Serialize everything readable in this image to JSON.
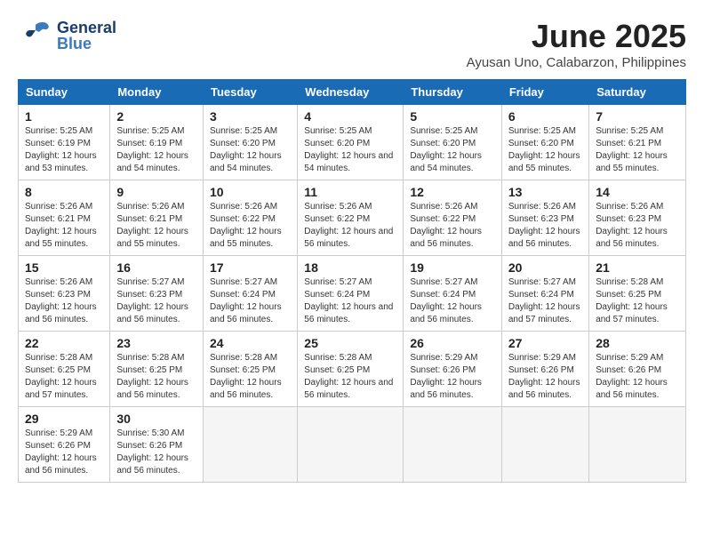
{
  "header": {
    "logo_general": "General",
    "logo_blue": "Blue",
    "month_title": "June 2025",
    "location": "Ayusan Uno, Calabarzon, Philippines"
  },
  "calendar": {
    "days_of_week": [
      "Sunday",
      "Monday",
      "Tuesday",
      "Wednesday",
      "Thursday",
      "Friday",
      "Saturday"
    ],
    "weeks": [
      [
        {
          "day": "",
          "empty": true
        },
        {
          "day": "",
          "empty": true
        },
        {
          "day": "",
          "empty": true
        },
        {
          "day": "",
          "empty": true
        },
        {
          "day": "",
          "empty": true
        },
        {
          "day": "",
          "empty": true
        },
        {
          "day": "",
          "empty": true
        }
      ]
    ],
    "cells": [
      {
        "day": "1",
        "sunrise": "5:25 AM",
        "sunset": "6:19 PM",
        "daylight": "12 hours and 53 minutes."
      },
      {
        "day": "2",
        "sunrise": "5:25 AM",
        "sunset": "6:19 PM",
        "daylight": "12 hours and 54 minutes."
      },
      {
        "day": "3",
        "sunrise": "5:25 AM",
        "sunset": "6:20 PM",
        "daylight": "12 hours and 54 minutes."
      },
      {
        "day": "4",
        "sunrise": "5:25 AM",
        "sunset": "6:20 PM",
        "daylight": "12 hours and 54 minutes."
      },
      {
        "day": "5",
        "sunrise": "5:25 AM",
        "sunset": "6:20 PM",
        "daylight": "12 hours and 54 minutes."
      },
      {
        "day": "6",
        "sunrise": "5:25 AM",
        "sunset": "6:20 PM",
        "daylight": "12 hours and 55 minutes."
      },
      {
        "day": "7",
        "sunrise": "5:25 AM",
        "sunset": "6:21 PM",
        "daylight": "12 hours and 55 minutes."
      },
      {
        "day": "8",
        "sunrise": "5:26 AM",
        "sunset": "6:21 PM",
        "daylight": "12 hours and 55 minutes."
      },
      {
        "day": "9",
        "sunrise": "5:26 AM",
        "sunset": "6:21 PM",
        "daylight": "12 hours and 55 minutes."
      },
      {
        "day": "10",
        "sunrise": "5:26 AM",
        "sunset": "6:22 PM",
        "daylight": "12 hours and 55 minutes."
      },
      {
        "day": "11",
        "sunrise": "5:26 AM",
        "sunset": "6:22 PM",
        "daylight": "12 hours and 56 minutes."
      },
      {
        "day": "12",
        "sunrise": "5:26 AM",
        "sunset": "6:22 PM",
        "daylight": "12 hours and 56 minutes."
      },
      {
        "day": "13",
        "sunrise": "5:26 AM",
        "sunset": "6:23 PM",
        "daylight": "12 hours and 56 minutes."
      },
      {
        "day": "14",
        "sunrise": "5:26 AM",
        "sunset": "6:23 PM",
        "daylight": "12 hours and 56 minutes."
      },
      {
        "day": "15",
        "sunrise": "5:26 AM",
        "sunset": "6:23 PM",
        "daylight": "12 hours and 56 minutes."
      },
      {
        "day": "16",
        "sunrise": "5:27 AM",
        "sunset": "6:23 PM",
        "daylight": "12 hours and 56 minutes."
      },
      {
        "day": "17",
        "sunrise": "5:27 AM",
        "sunset": "6:24 PM",
        "daylight": "12 hours and 56 minutes."
      },
      {
        "day": "18",
        "sunrise": "5:27 AM",
        "sunset": "6:24 PM",
        "daylight": "12 hours and 56 minutes."
      },
      {
        "day": "19",
        "sunrise": "5:27 AM",
        "sunset": "6:24 PM",
        "daylight": "12 hours and 56 minutes."
      },
      {
        "day": "20",
        "sunrise": "5:27 AM",
        "sunset": "6:24 PM",
        "daylight": "12 hours and 57 minutes."
      },
      {
        "day": "21",
        "sunrise": "5:28 AM",
        "sunset": "6:25 PM",
        "daylight": "12 hours and 57 minutes."
      },
      {
        "day": "22",
        "sunrise": "5:28 AM",
        "sunset": "6:25 PM",
        "daylight": "12 hours and 57 minutes."
      },
      {
        "day": "23",
        "sunrise": "5:28 AM",
        "sunset": "6:25 PM",
        "daylight": "12 hours and 56 minutes."
      },
      {
        "day": "24",
        "sunrise": "5:28 AM",
        "sunset": "6:25 PM",
        "daylight": "12 hours and 56 minutes."
      },
      {
        "day": "25",
        "sunrise": "5:28 AM",
        "sunset": "6:25 PM",
        "daylight": "12 hours and 56 minutes."
      },
      {
        "day": "26",
        "sunrise": "5:29 AM",
        "sunset": "6:26 PM",
        "daylight": "12 hours and 56 minutes."
      },
      {
        "day": "27",
        "sunrise": "5:29 AM",
        "sunset": "6:26 PM",
        "daylight": "12 hours and 56 minutes."
      },
      {
        "day": "28",
        "sunrise": "5:29 AM",
        "sunset": "6:26 PM",
        "daylight": "12 hours and 56 minutes."
      },
      {
        "day": "29",
        "sunrise": "5:29 AM",
        "sunset": "6:26 PM",
        "daylight": "12 hours and 56 minutes."
      },
      {
        "day": "30",
        "sunrise": "5:30 AM",
        "sunset": "6:26 PM",
        "daylight": "12 hours and 56 minutes."
      }
    ]
  }
}
